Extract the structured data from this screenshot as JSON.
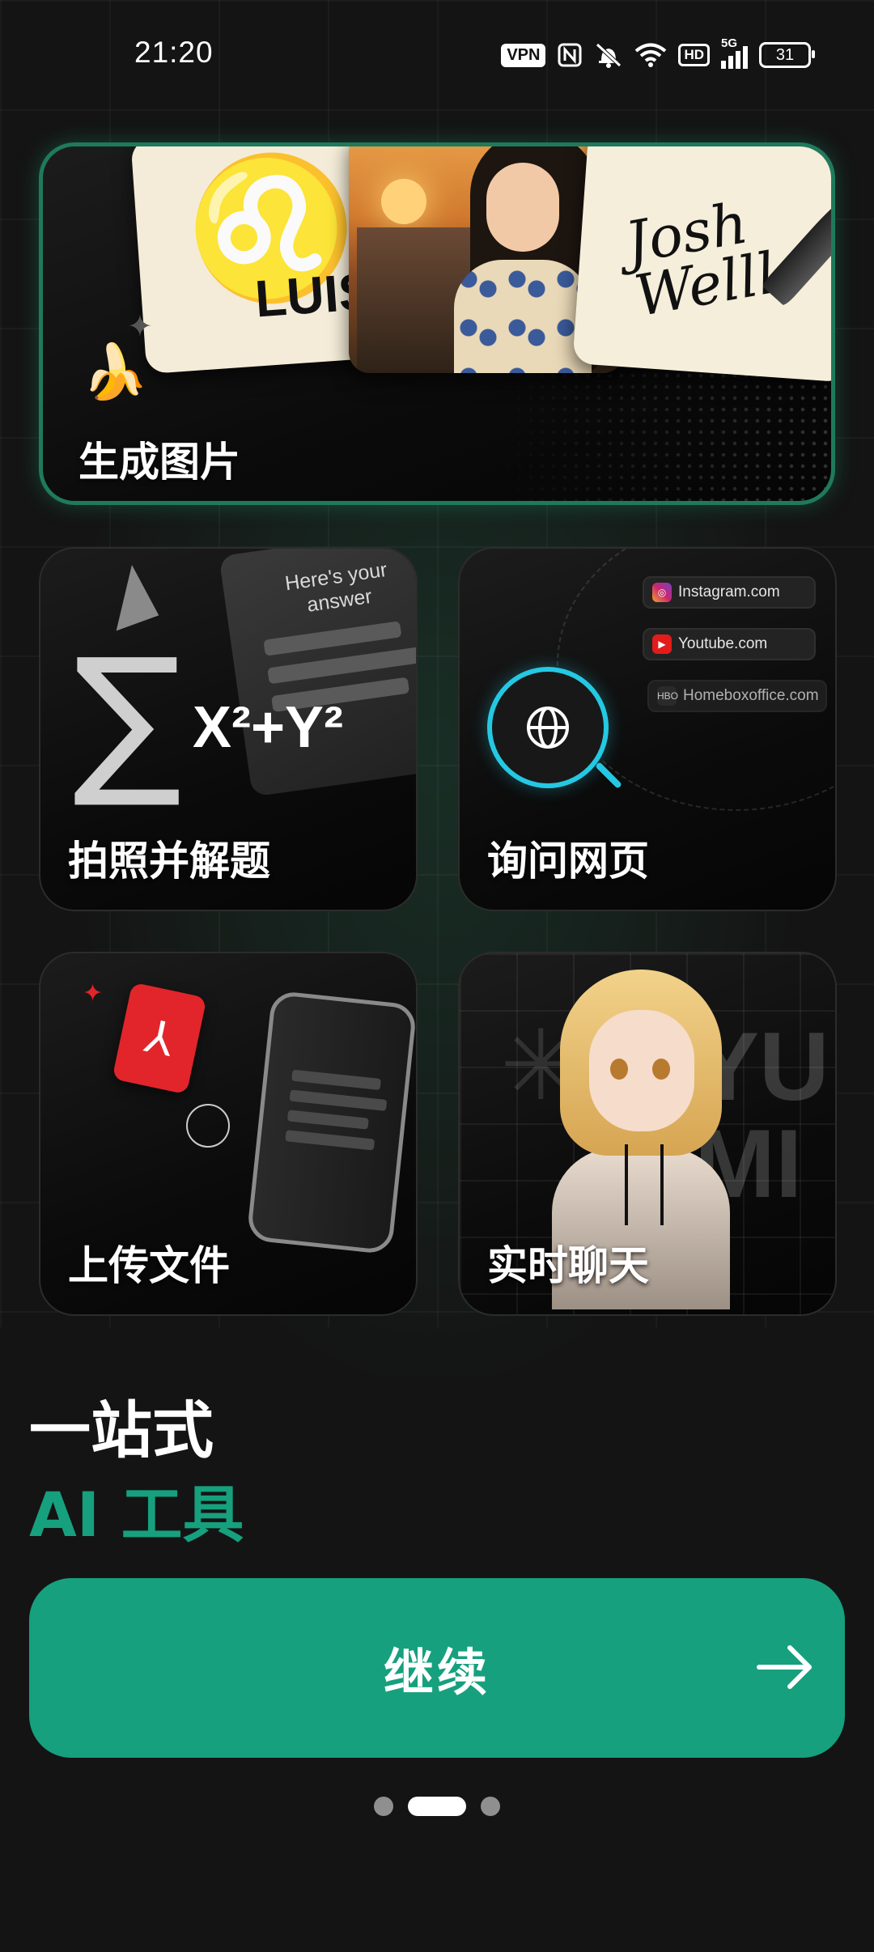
{
  "status_bar": {
    "time": "21:20",
    "vpn": "VPN",
    "hd": "HD",
    "network": "5G",
    "battery": "31"
  },
  "cards": {
    "hero": {
      "label": "生成图片",
      "logo_text": "LUIS",
      "signature_text": "Josh Wellls"
    },
    "math": {
      "label": "拍照并解题",
      "paper_text": "Here's your answer",
      "formula": "X²+Y²"
    },
    "web": {
      "label": "询问网页",
      "sites": [
        "Instagram.com",
        "Youtube.com",
        "Homeboxoffice.com"
      ]
    },
    "upload": {
      "label": "上传文件"
    },
    "chat": {
      "label": "实时聊天",
      "watermark": "YU MI"
    }
  },
  "headline": "一站式",
  "headline_accent": "AI 工具",
  "continue_button": {
    "label": "继续"
  },
  "pager": {
    "count": 3,
    "active_index": 1
  },
  "colors": {
    "accent": "#16a07e",
    "background": "#141414",
    "magnifier": "#25c8e2"
  },
  "icons": [
    "vpn-icon",
    "nfc-icon",
    "mute-icon",
    "wifi-icon",
    "signal-icon",
    "battery-icon",
    "banana-icon",
    "globe-icon",
    "pdf-icon",
    "arrow-right-icon"
  ]
}
